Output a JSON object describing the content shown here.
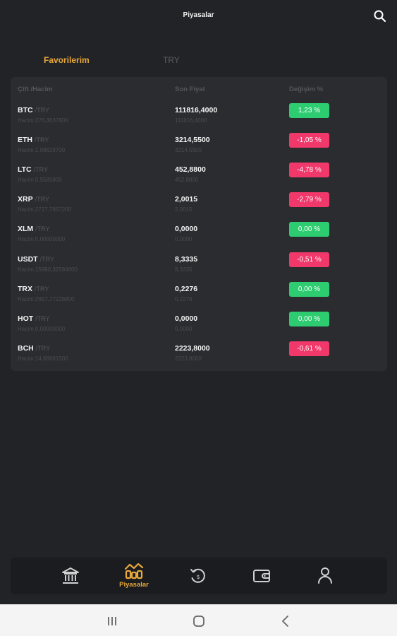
{
  "header": {
    "title": "Piyasalar"
  },
  "tabs": [
    {
      "label": "Favorilerim",
      "active": true
    },
    {
      "label": "TRY",
      "active": false
    }
  ],
  "table": {
    "headers": [
      "Çift /Hacim",
      "Son Fiyat",
      "Değişim %"
    ],
    "rows": [
      {
        "base": "BTC",
        "quote": "/TRY",
        "volume": "Hacim:276,3637800",
        "price": "111816,4000",
        "price_sub": "111816,4000",
        "change": "1,23 %",
        "direction": "up"
      },
      {
        "base": "ETH",
        "quote": "/TRY",
        "volume": "Hacim:1,08629700",
        "price": "3214,5500",
        "price_sub": "3214,5500",
        "change": "-1,05 %",
        "direction": "down"
      },
      {
        "base": "LTC",
        "quote": "/TRY",
        "volume": "Hacim:0,5585800",
        "price": "452,8800",
        "price_sub": "452,8800",
        "change": "-4,78 %",
        "direction": "down"
      },
      {
        "base": "XRP",
        "quote": "/TRY",
        "volume": "Hacim:2727,7857200",
        "price": "2,0015",
        "price_sub": "2,0015",
        "change": "-2,79 %",
        "direction": "down"
      },
      {
        "base": "XLM",
        "quote": "/TRY",
        "volume": "Hacim:0,00000000",
        "price": "0,0000",
        "price_sub": "0,0000",
        "change": "0,00 %",
        "direction": "up"
      },
      {
        "base": "USDT",
        "quote": "/TRY",
        "volume": "Hacim:15980,32584600",
        "price": "8,3335",
        "price_sub": "8,3335",
        "change": "-0,51 %",
        "direction": "down"
      },
      {
        "base": "TRX",
        "quote": "/TRY",
        "volume": "Hacim:2657,77228800",
        "price": "0,2276",
        "price_sub": "0,2276",
        "change": "0,00 %",
        "direction": "up"
      },
      {
        "base": "HOT",
        "quote": "/TRY",
        "volume": "Hacim:0,00000000",
        "price": "0,0000",
        "price_sub": "0,0000",
        "change": "0,00 %",
        "direction": "up"
      },
      {
        "base": "BCH",
        "quote": "/TRY",
        "volume": "Hacim:14,66681500",
        "price": "2223,8000",
        "price_sub": "2223,8000",
        "change": "-0,61 %",
        "direction": "down"
      }
    ]
  },
  "bottom_nav": {
    "items": [
      {
        "icon": "bank-icon",
        "label": ""
      },
      {
        "icon": "markets-icon",
        "label": "Piyasalar",
        "active": true
      },
      {
        "icon": "history-icon",
        "label": ""
      },
      {
        "icon": "wallet-icon",
        "label": ""
      },
      {
        "icon": "user-icon",
        "label": ""
      }
    ]
  },
  "colors": {
    "accent": "#e9a93c",
    "positive": "#2ecc71",
    "negative": "#f0386b",
    "background": "#222326",
    "card": "#2b2c30"
  }
}
